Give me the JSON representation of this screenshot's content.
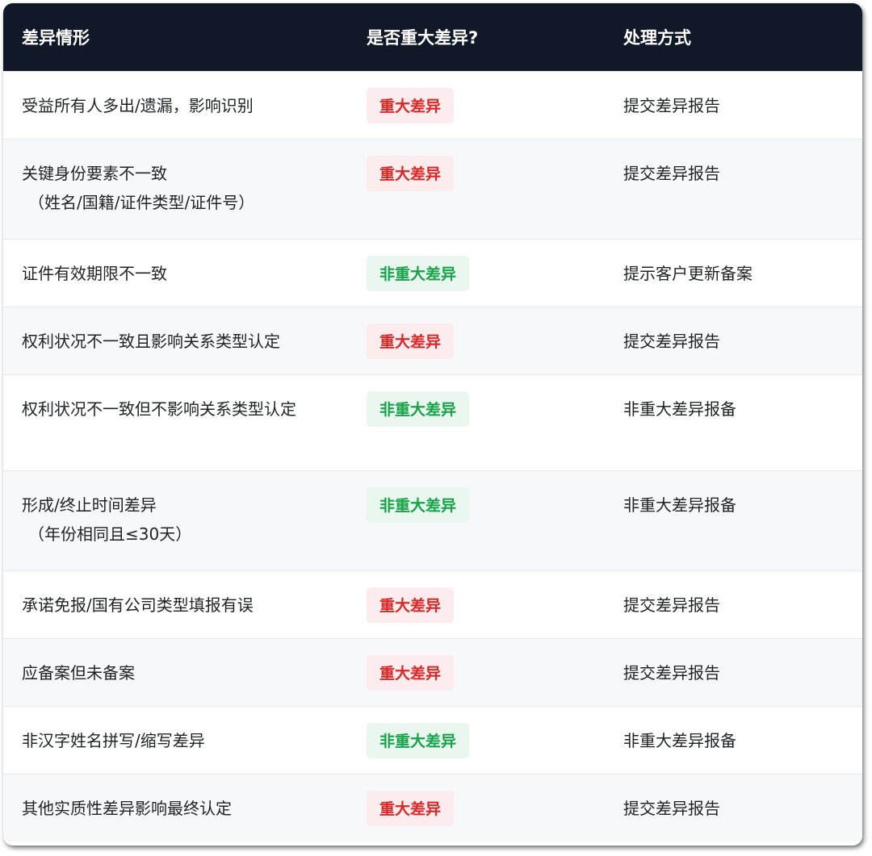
{
  "header": {
    "col1": "差异情形",
    "col2": "是否重大差异?",
    "col3": "处理方式"
  },
  "rows": [
    {
      "situation": "受益所有人多出/遗漏，影响识别",
      "situation_note": "",
      "type": "major",
      "badge": "重大差异",
      "action": "提交差异报告"
    },
    {
      "situation": "关键身份要素不一致",
      "situation_note": "（姓名/国籍/证件类型/证件号）",
      "type": "major",
      "badge": "重大差异",
      "action": "提交差异报告"
    },
    {
      "situation": "证件有效期限不一致",
      "situation_note": "",
      "type": "minor",
      "badge": "非重大差异",
      "action": "提示客户更新备案"
    },
    {
      "situation": "权利状况不一致且影响关系类型认定",
      "situation_note": "",
      "type": "major",
      "badge": "重大差异",
      "action": "提交差异报告"
    },
    {
      "situation": "权利状况不一致但不影响关系类型认定",
      "situation_note": "",
      "type": "minor",
      "badge": "非重大差异",
      "action": "非重大差异报备"
    },
    {
      "situation": "形成/终止时间差异",
      "situation_note": "（年份相同且≤30天）",
      "type": "minor",
      "badge": "非重大差异",
      "action": "非重大差异报备"
    },
    {
      "situation": "承诺免报/国有公司类型填报有误",
      "situation_note": "",
      "type": "major",
      "badge": "重大差异",
      "action": "提交差异报告"
    },
    {
      "situation": "应备案但未备案",
      "situation_note": "",
      "type": "major",
      "badge": "重大差异",
      "action": "提交差异报告"
    },
    {
      "situation": "非汉字姓名拼写/缩写差异",
      "situation_note": "",
      "type": "minor",
      "badge": "非重大差异",
      "action": "非重大差异报备"
    },
    {
      "situation": "其他实质性差异影响最终认定",
      "situation_note": "",
      "type": "major",
      "badge": "重大差异",
      "action": "提交差异报告"
    }
  ],
  "colors": {
    "header_bg": "#111827",
    "major_text": "#dc2626",
    "major_bg": "#fdeced",
    "minor_text": "#16a34a",
    "minor_bg": "#eaf7ee"
  }
}
